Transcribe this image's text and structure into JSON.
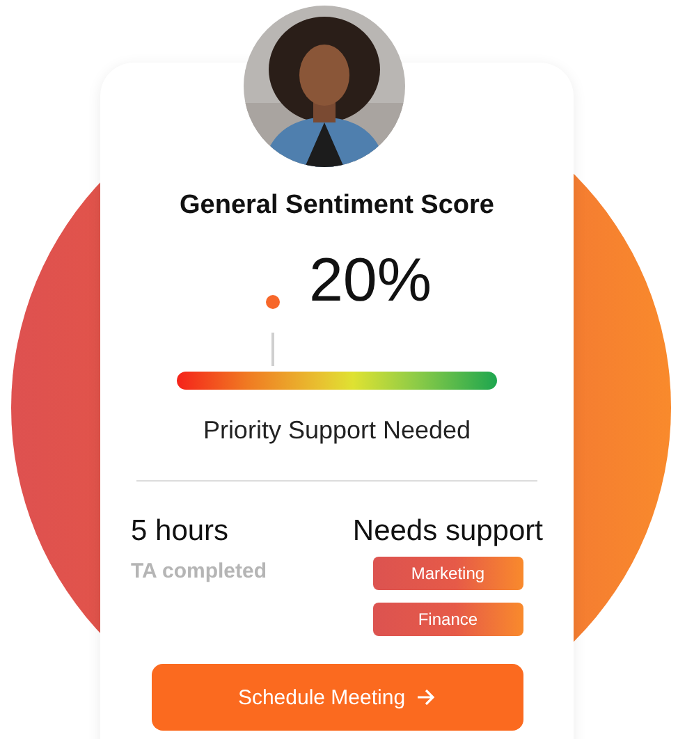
{
  "card": {
    "title": "General Sentiment Score",
    "score": "20%",
    "gauge": {
      "level": 0.3
    },
    "status": "Priority Support Needed",
    "stats": {
      "hours": "5 hours",
      "hours_label": "TA completed",
      "support_heading": "Needs support",
      "tags": [
        "Marketing",
        "Finance"
      ]
    },
    "button": "Schedule Meeting"
  }
}
